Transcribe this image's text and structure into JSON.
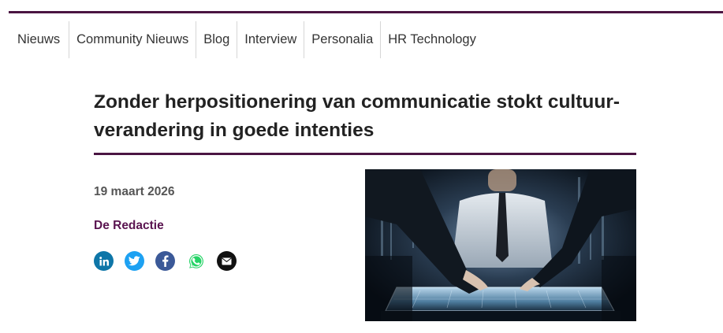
{
  "nav": {
    "items": [
      {
        "label": "Nieuws"
      },
      {
        "label": "Community Nieuws"
      },
      {
        "label": "Blog"
      },
      {
        "label": "Interview"
      },
      {
        "label": "Personalia"
      },
      {
        "label": "HR Technology"
      }
    ]
  },
  "article": {
    "title": "Zonder herpositionering van communicatie stokt cultuur-verandering in goede intenties",
    "date": "19 maart 2026",
    "author": "De Redactie",
    "image_icon": "business-people-touchscreen-table-photo"
  },
  "share": {
    "buttons": [
      {
        "icon": "linkedin-icon",
        "color": "#0e76a8"
      },
      {
        "icon": "twitter-icon",
        "color": "#1da1f2"
      },
      {
        "icon": "facebook-icon",
        "color": "#3b5998"
      },
      {
        "icon": "whatsapp-icon",
        "color": "#25d366"
      },
      {
        "icon": "email-icon",
        "color": "#111111"
      }
    ]
  },
  "colors": {
    "accent": "#4a1542",
    "author": "#5a1450"
  }
}
